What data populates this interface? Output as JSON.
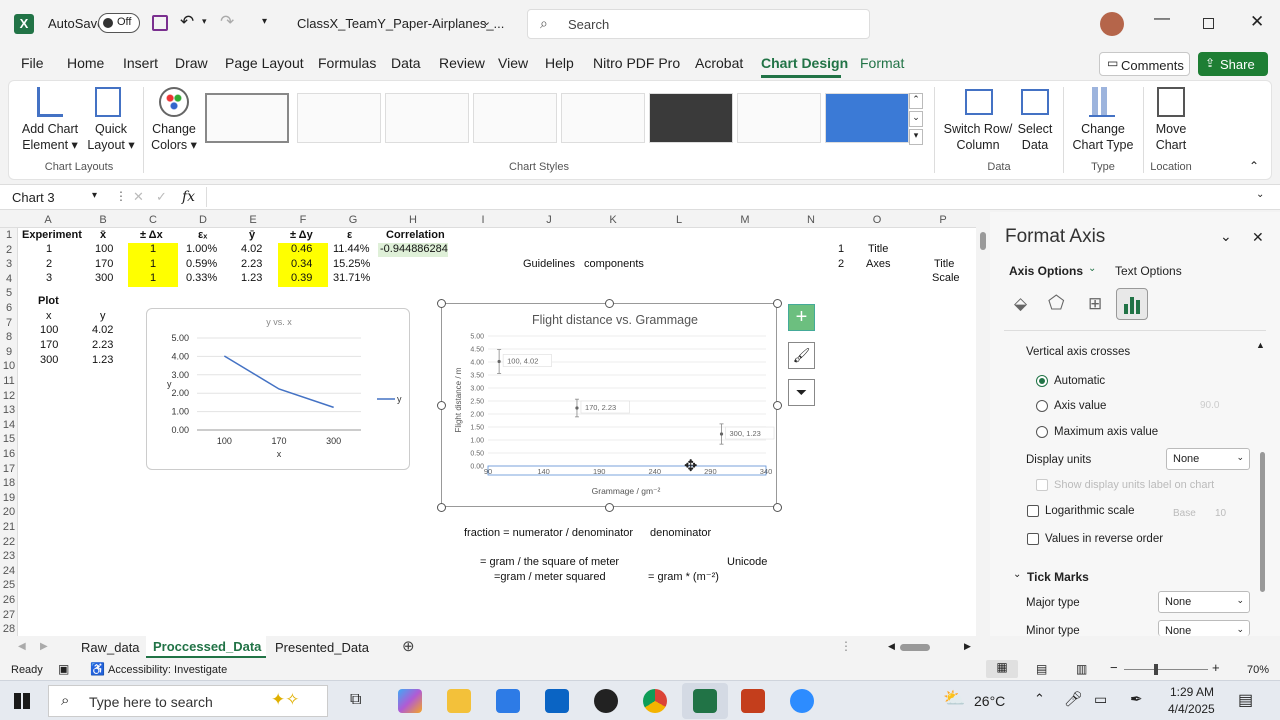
{
  "titlebar": {
    "autosave_label": "AutoSave",
    "autosave_state": "Off",
    "filename": "ClassX_TeamY_Paper-Airplanes_...",
    "search_placeholder": "Search"
  },
  "menu": [
    "File",
    "Home",
    "Insert",
    "Draw",
    "Page Layout",
    "Formulas",
    "Data",
    "Review",
    "View",
    "Help",
    "Nitro PDF Pro",
    "Acrobat",
    "Chart Design",
    "Format"
  ],
  "menu_active": "Chart Design",
  "comments_label": "Comments",
  "share_label": "Share",
  "ribbon": {
    "add_chart_element": [
      "Add Chart",
      "Element"
    ],
    "quick_layout": [
      "Quick",
      "Layout"
    ],
    "change_colors": [
      "Change",
      "Colors"
    ],
    "switch_row_col": [
      "Switch Row/",
      "Column"
    ],
    "select_data": [
      "Select",
      "Data"
    ],
    "change_chart_type": [
      "Change",
      "Chart Type"
    ],
    "move_chart": [
      "Move",
      "Chart"
    ],
    "groups": {
      "chart_layouts": "Chart Layouts",
      "chart_styles": "Chart Styles",
      "data": "Data",
      "type": "Type",
      "location": "Location"
    }
  },
  "formula": {
    "name_box": "Chart 3",
    "fx": "fx"
  },
  "columns": [
    "A",
    "B",
    "C",
    "D",
    "E",
    "F",
    "G",
    "H",
    "I",
    "J",
    "K",
    "L",
    "M",
    "N",
    "O",
    "P"
  ],
  "rows": [
    "1",
    "2",
    "3",
    "4",
    "5",
    "6",
    "7",
    "8",
    "9",
    "10",
    "11",
    "12",
    "13",
    "14",
    "15",
    "16",
    "17",
    "18",
    "19",
    "20",
    "21",
    "22",
    "23",
    "24",
    "25",
    "26",
    "27",
    "28"
  ],
  "table": {
    "headers": [
      "Experiment",
      "x̄",
      "± Δx",
      "εₓ",
      "ȳ",
      "± Δy",
      "ε",
      "Correlation"
    ],
    "rows": [
      [
        "1",
        "100",
        "1",
        "1.00%",
        "4.02",
        "0.46",
        "11.44%",
        "-0.944886284"
      ],
      [
        "2",
        "170",
        "1",
        "0.59%",
        "2.23",
        "0.34",
        "15.25%",
        ""
      ],
      [
        "3",
        "300",
        "1",
        "0.33%",
        "1.23",
        "0.39",
        "31.71%",
        ""
      ]
    ]
  },
  "plot_table": {
    "title": "Plot",
    "headers": [
      "x",
      "y"
    ],
    "rows": [
      [
        "100",
        "4.02"
      ],
      [
        "170",
        "2.23"
      ],
      [
        "300",
        "1.23"
      ]
    ]
  },
  "side_cells": {
    "n2": "1",
    "o2": "Title",
    "n3": "2",
    "o3": "Axes",
    "p3": "Title",
    "p4": "Scale",
    "j3": "Guidelines",
    "k3": "components"
  },
  "notes": {
    "line1a": "fraction = numerator / denominator",
    "line1b": "denominator",
    "line2a": "= gram / the square of meter",
    "line2b": "Unicode",
    "line3a": "=gram / meter squared",
    "line3b": "= gram * (m⁻²)"
  },
  "small_chart": {
    "title": "y vs. x",
    "xlabel": "x",
    "ylabel": "y",
    "legend": "y",
    "y_ticks": [
      "5.00",
      "4.00",
      "3.00",
      "2.00",
      "1.00",
      "0.00"
    ],
    "x_ticks": [
      "100",
      "170",
      "300"
    ]
  },
  "chart_data": [
    {
      "type": "line",
      "title": "y vs. x",
      "categories": [
        "100",
        "170",
        "300"
      ],
      "series": [
        {
          "name": "y",
          "values": [
            4.02,
            2.23,
            1.23
          ]
        }
      ],
      "xlabel": "x",
      "ylabel": "y",
      "ylim": [
        0,
        5
      ],
      "legend": "right"
    },
    {
      "type": "scatter",
      "title": "Flight distance vs. Grammage",
      "x": [
        100,
        170,
        300
      ],
      "y": [
        4.02,
        2.23,
        1.23
      ],
      "y_err": [
        0.46,
        0.34,
        0.39
      ],
      "point_labels": [
        "100, 4.02",
        "170, 2.23",
        "300, 1.23"
      ],
      "xlabel": "Grammage / gm⁻²",
      "ylabel": "Flight distance / m",
      "xlim": [
        90,
        340
      ],
      "ylim": [
        0,
        5
      ],
      "x_ticks": [
        "90",
        "140",
        "190",
        "240",
        "290",
        "340"
      ],
      "y_ticks": [
        "5.00",
        "4.50",
        "4.00",
        "3.50",
        "3.00",
        "2.50",
        "2.00",
        "1.50",
        "1.00",
        "0.50",
        "0.00"
      ]
    }
  ],
  "pane": {
    "title": "Format Axis",
    "tab_axis": "Axis Options",
    "tab_text": "Text Options",
    "vertical_axis_crosses": "Vertical axis crosses",
    "opt_automatic": "Automatic",
    "opt_axis_value": "Axis value",
    "opt_max": "Maximum axis value",
    "axis_value_input": "90.0",
    "display_units": "Display units",
    "display_units_value": "None",
    "show_units_label": "Show display units label on chart",
    "log_scale": "Logarithmic scale",
    "base_label": "Base",
    "base_value": "10",
    "reverse": "Values in reverse order",
    "tick_marks": "Tick Marks",
    "major_type": "Major type",
    "major_value": "None",
    "minor_type": "Minor type",
    "minor_value": "None"
  },
  "sheet_tabs": [
    "Raw_data",
    "Proccessed_Data",
    "Presented_Data"
  ],
  "sheet_active": "Proccessed_Data",
  "status": {
    "ready": "Ready",
    "accessibility": "Accessibility: Investigate",
    "zoom": "70%"
  },
  "taskbar": {
    "search": "Type here to search",
    "temp": "26°C",
    "time": "1:29 AM",
    "date": "4/4/2025"
  },
  "colors": {
    "excel_green": "#217346",
    "share_green": "#1e7e34",
    "highlight": "#ffff00",
    "series": "#4472c4"
  }
}
